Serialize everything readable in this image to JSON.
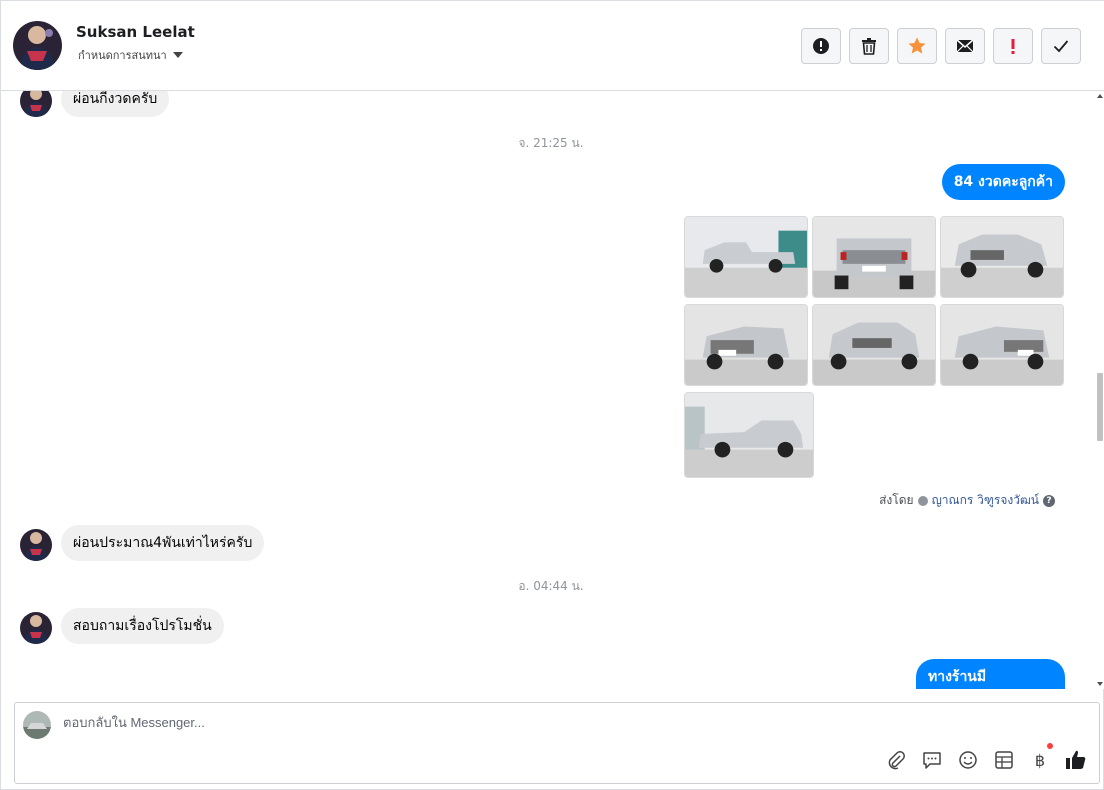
{
  "header": {
    "name": "Suksan Leelat",
    "subtitle": "กำหนดการสนทนา",
    "actions": [
      {
        "name": "spam-button",
        "icon": "alert-circle-icon"
      },
      {
        "name": "delete-button",
        "icon": "trash-icon"
      },
      {
        "name": "star-button",
        "icon": "star-icon",
        "color": "#f7923b"
      },
      {
        "name": "mark-unread-button",
        "icon": "envelope-icon"
      },
      {
        "name": "follow-up-button",
        "icon": "exclamation-icon",
        "color": "#e41e3f"
      },
      {
        "name": "done-button",
        "icon": "check-icon"
      }
    ]
  },
  "thread": {
    "msg_first": "ผ่อนกี่งวดครับ",
    "time_1": "จ. 21:25 น.",
    "msg_out_1": "84 งวดคะลูกค้า",
    "photo_count": 7,
    "sent_by_label": "ส่งโดย",
    "sent_by_name": "ญาณกร วิฑูรจงวัฒน์",
    "msg_in_2": "ผ่อนประมาณ4พันเท่าไหร่ครับ",
    "time_2": "อ. 04:44 น.",
    "msg_in_3": "สอบถามเรื่องโปรโมชั่น",
    "msg_out_2": "ทางร้านมี"
  },
  "composer": {
    "placeholder": "ตอบกลับใน Messenger...",
    "tools": [
      "paperclip-icon",
      "chat-bubble-icon",
      "smiley-icon",
      "table-icon",
      "baht-icon",
      "thumbs-up-icon"
    ],
    "baht_symbol": "฿",
    "accent_color": "#0084ff"
  }
}
